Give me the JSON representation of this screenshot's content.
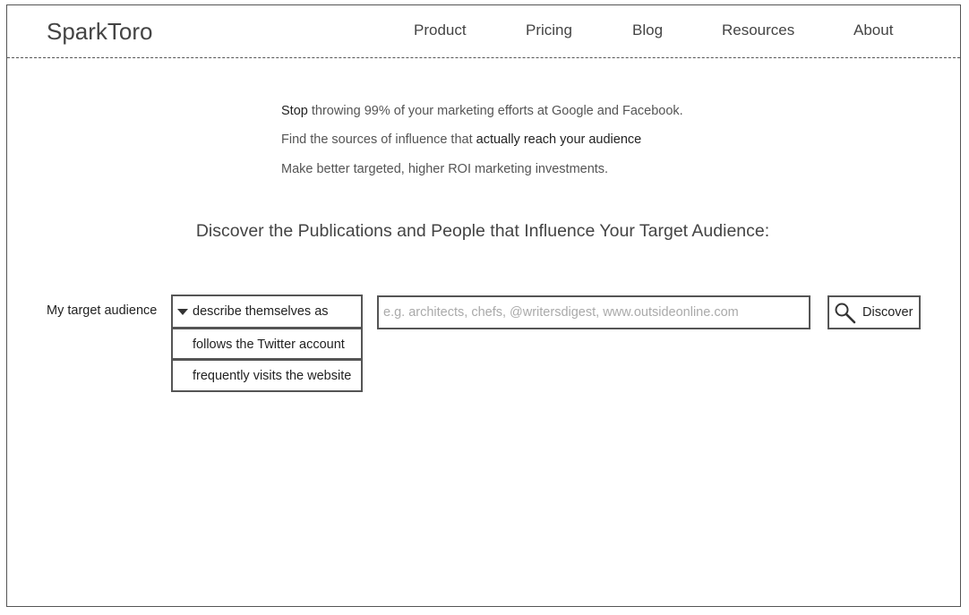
{
  "header": {
    "logo": "SparkToro",
    "nav": [
      "Product",
      "Pricing",
      "Blog",
      "Resources",
      "About"
    ]
  },
  "intro": {
    "line1_em": "Stop",
    "line1_rest": " throwing 99% of your marketing efforts at Google and Facebook.",
    "line2_pre": "Find the sources of influence that ",
    "line2_em": "actually reach your audience",
    "line3": "Make better targeted, higher ROI marketing investments."
  },
  "headline": "Discover the Publications and People that Influence Your Target Audience:",
  "form": {
    "audience_label": "My target audience",
    "dropdown": {
      "selected": "describe themselves as",
      "options": [
        "follows the Twitter account",
        "frequently visits the website"
      ]
    },
    "search_placeholder": "e.g. architects, chefs, @writersdigest, www.outsideonline.com",
    "search_value": "",
    "discover_label": "Discover",
    "discover_icon": "magnifier-icon"
  }
}
